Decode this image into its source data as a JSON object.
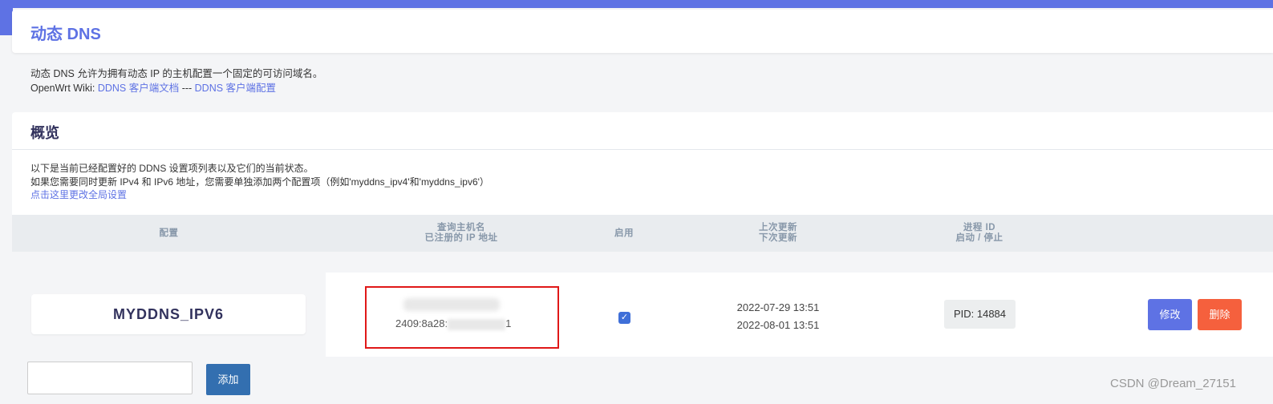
{
  "page": {
    "title": "动态 DNS",
    "description_line1": "动态 DNS 允许为拥有动态 IP 的主机配置一个固定的可访问域名。",
    "wiki_prefix": "OpenWrt Wiki: ",
    "wiki_link1": "DDNS 客户端文档",
    "wiki_separator": " --- ",
    "wiki_link2": "DDNS 客户端配置"
  },
  "overview": {
    "title": "概览",
    "line1": "以下是当前已经配置好的 DDNS 设置项列表以及它们的当前状态。",
    "line2": "如果您需要同时更新 IPv4 和 IPv6 地址，您需要单独添加两个配置项（例如'myddns_ipv4'和'myddns_ipv6'）",
    "global_link": "点击这里更改全局设置"
  },
  "table": {
    "headers": {
      "config": "配置",
      "host_line1": "查询主机名",
      "host_line2": "已注册的 IP 地址",
      "enabled": "启用",
      "update_line1": "上次更新",
      "update_line2": "下次更新",
      "pid_line1": "进程 ID",
      "pid_line2": "启动 / 停止"
    },
    "rows": [
      {
        "name": "MYDDNS_IPV6",
        "ip_visible_prefix": "2409:8a28:",
        "ip_visible_suffix": "1",
        "enabled": true,
        "last_update": "2022-07-29 13:51",
        "next_update": "2022-08-01 13:51",
        "pid": "PID: 14884",
        "edit_label": "修改",
        "delete_label": "删除"
      }
    ]
  },
  "add": {
    "button_label": "添加",
    "input_value": ""
  },
  "watermark": "CSDN @Dream_27151",
  "colors": {
    "accent": "#5e72e4",
    "delete": "#f5603d",
    "add_button": "#336fb0",
    "highlight": "#e01818"
  }
}
